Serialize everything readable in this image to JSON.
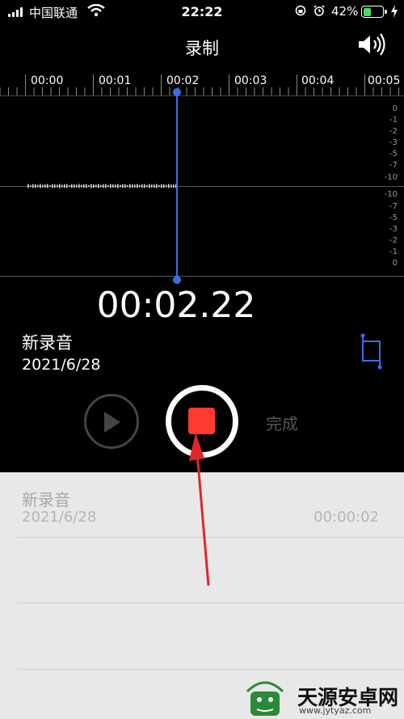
{
  "status_bar": {
    "carrier": "中国联通",
    "time": "22:22",
    "battery": "42%",
    "battery_level": 0.42,
    "battery_color": "#4cd964"
  },
  "header": {
    "title": "录制",
    "speaker_icon": "speaker-icon"
  },
  "timeline": {
    "ticks": [
      "00:00",
      "00:01",
      "00:02",
      "00:03",
      "00:04",
      "00:05"
    ]
  },
  "waveform": {
    "db_top": [
      "0",
      "-1",
      "-2",
      "-3",
      "-5",
      "-7",
      "-10"
    ],
    "db_bottom": [
      "-10",
      "-7",
      "-5",
      "-3",
      "-2",
      "-1",
      "0"
    ],
    "playhead_color": "#3b6fe6"
  },
  "recording": {
    "elapsed": "00:02.22",
    "name": "新录音",
    "date": "2021/6/28"
  },
  "controls": {
    "play_icon": "play-icon",
    "stop_icon": "stop-icon",
    "record_color": "#ff3b30",
    "done_label": "完成"
  },
  "list": {
    "items": [
      {
        "name": "新录音",
        "date": "2021/6/28",
        "duration": "00:00:02"
      }
    ]
  },
  "watermark": {
    "brand": "天源安卓网",
    "url": "www.jytyaz.com"
  }
}
